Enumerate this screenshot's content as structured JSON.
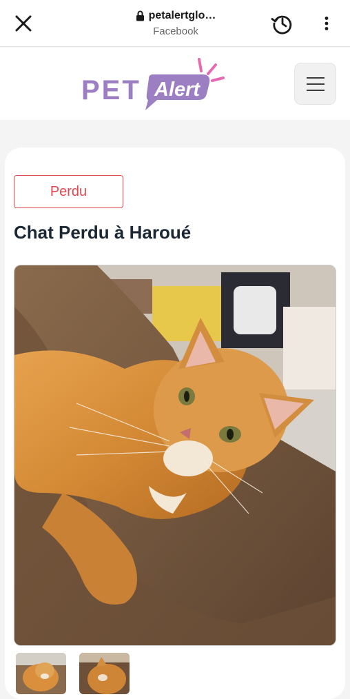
{
  "browser": {
    "url": "petalertglo…",
    "site_name": "Facebook",
    "icons": [
      "close-icon",
      "lock-icon",
      "history-icon",
      "more-vert-icon"
    ]
  },
  "header": {
    "logo_pet": "PET",
    "logo_alert": "Alert",
    "brand_colors": {
      "purple": "#9b7fc2",
      "pink": "#e46bb0"
    }
  },
  "listing": {
    "status_label": "Perdu",
    "status_color": "#e0474f",
    "title": "Chat Perdu à Haroué",
    "photo_count_visible": 2
  }
}
